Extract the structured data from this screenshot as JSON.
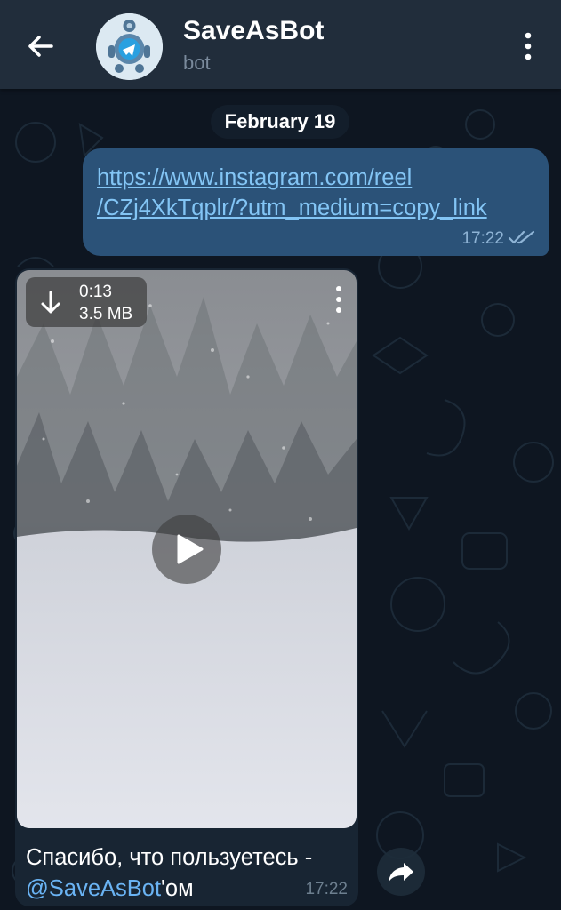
{
  "header": {
    "title": "SaveAsBot",
    "subtitle": "bot",
    "back_icon": "arrow-left-icon",
    "menu_icon": "more-vertical-icon"
  },
  "date_separator": "February 19",
  "outgoing_message": {
    "link_line1": "https://www.instagram.com/reel",
    "link_line2": "/CZj4XkTqplr/?utm_medium=copy_link",
    "time": "17:22",
    "status_icon": "double-check-icon"
  },
  "incoming_message": {
    "video": {
      "duration": "0:13",
      "size": "3.5 MB",
      "download_icon": "download-arrow-icon",
      "play_icon": "play-icon",
      "menu_icon": "more-vertical-icon"
    },
    "caption_part1": "Спасибо, что пользуетесь -",
    "caption_mention": "@SaveAsBot",
    "caption_part2": "'ом",
    "time": "17:22"
  },
  "share_icon": "share-forward-icon",
  "colors": {
    "background": "#0e1621",
    "header": "#212d3b",
    "outgoing_bubble": "#2b5278",
    "incoming_bubble": "#182533",
    "link": "#83c5f5",
    "mention": "#6ab3f3"
  }
}
